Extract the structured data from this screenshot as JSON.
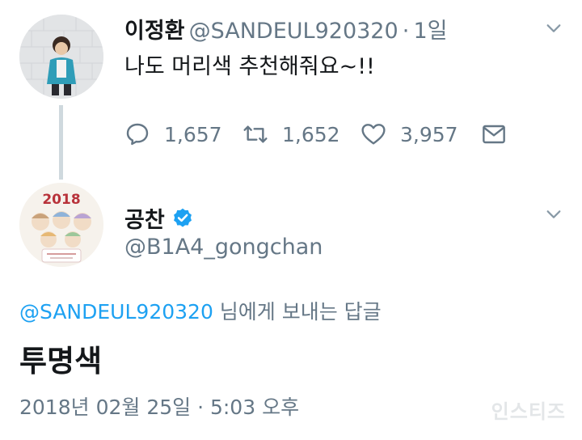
{
  "tweet1": {
    "name": "이정환",
    "handle": "@SANDEUL920320",
    "separator": "·",
    "time": "1일",
    "text": "나도 머리색 추천해줘요~!!",
    "replies": "1,657",
    "retweets": "1,652",
    "likes": "3,957"
  },
  "tweet2": {
    "name": "공찬",
    "handle": "@B1A4_gongchan",
    "reply_to_handle": "@SANDEUL920320",
    "reply_to_suffix": " 님에게 보내는 답글",
    "text": "투명색",
    "timestamp": "2018년 02월 25일 · 5:03 오후"
  },
  "avatar2_year": "2018",
  "watermark": "인스티즈",
  "icons": {
    "reply": "reply-icon",
    "retweet": "retweet-icon",
    "like": "heart-icon",
    "dm": "envelope-icon",
    "more": "chevron-down-icon",
    "verified": "verified-badge-icon"
  },
  "colors": {
    "text": "#14171a",
    "secondary": "#657786",
    "link": "#1da1f2",
    "verified": "#1da1f2",
    "thread_line": "#cfd9de"
  }
}
